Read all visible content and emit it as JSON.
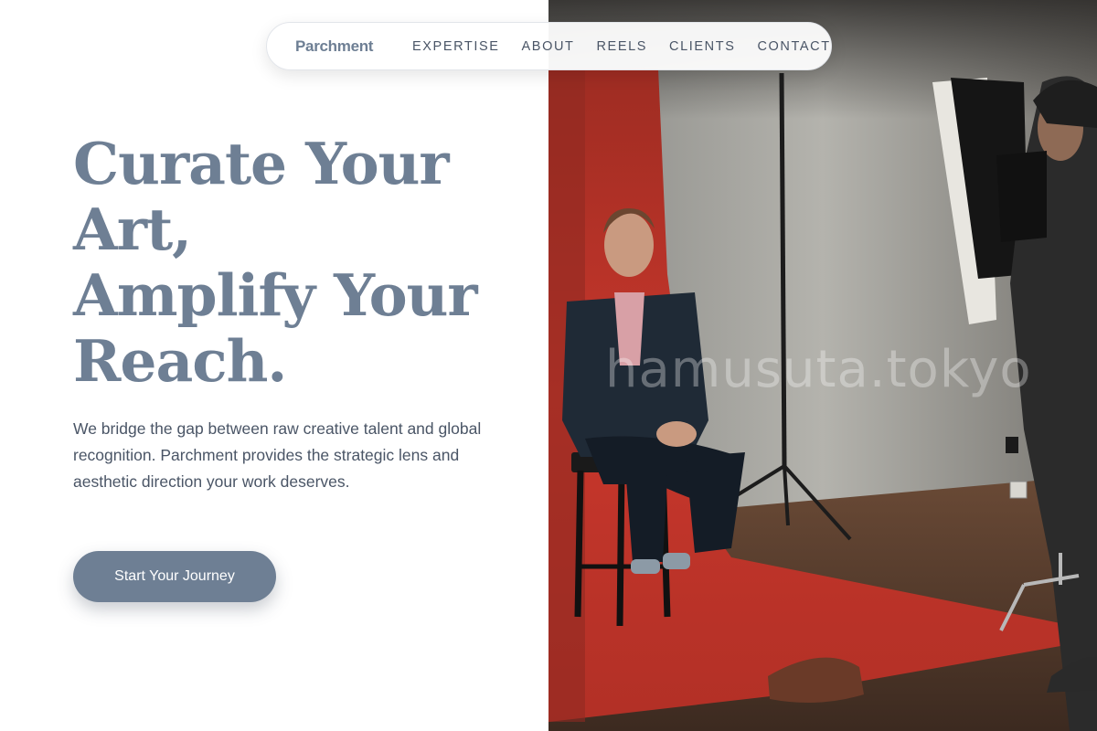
{
  "nav": {
    "brand": "Parchment",
    "links": [
      "EXPERTISE",
      "ABOUT",
      "REELS",
      "CLIENTS",
      "CONTACT"
    ]
  },
  "hero": {
    "headline_lines": [
      "Curate Your",
      "Art,",
      "Amplify Your",
      "Reach."
    ],
    "description": "We bridge the gap between raw creative talent and global recognition. Parchment provides the strategic lens and aesthetic direction your work deserves.",
    "cta_label": "Start Your Journey"
  },
  "photo": {
    "watermark": "hamusuta.tokyo"
  },
  "colors": {
    "accent": "#6e7f94",
    "text": "#4a5566",
    "backdrop_red": "#c8372c"
  }
}
